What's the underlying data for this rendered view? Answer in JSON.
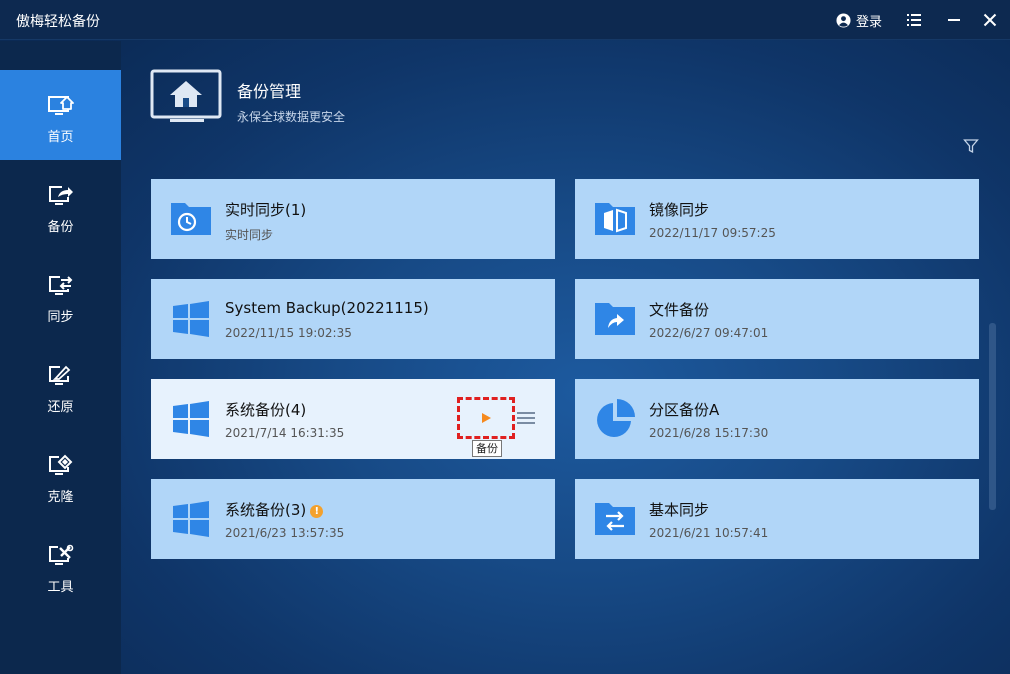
{
  "app": {
    "title": "傲梅轻松备份",
    "login_label": "登录"
  },
  "sidebar": {
    "items": [
      {
        "label": "首页",
        "icon": "home-monitor-icon",
        "active": true
      },
      {
        "label": "备份",
        "icon": "backup-icon",
        "active": false
      },
      {
        "label": "同步",
        "icon": "sync-icon",
        "active": false
      },
      {
        "label": "还原",
        "icon": "restore-icon",
        "active": false
      },
      {
        "label": "克隆",
        "icon": "clone-icon",
        "active": false
      },
      {
        "label": "工具",
        "icon": "tools-icon",
        "active": false
      }
    ]
  },
  "header": {
    "title": "备份管理",
    "subtitle": "永保全球数据更安全"
  },
  "tasks": [
    {
      "title": "实时同步(1)",
      "subtitle": "实时同步",
      "icon": "clock-folder-icon"
    },
    {
      "title": "镜像同步",
      "subtitle": "2022/11/17 09:57:25",
      "icon": "mirror-sync-icon"
    },
    {
      "title": "System Backup(20221115)",
      "subtitle": "2022/11/15 19:02:35",
      "icon": "windows-icon"
    },
    {
      "title": "文件备份",
      "subtitle": "2022/6/27 09:47:01",
      "icon": "file-backup-folder-icon"
    },
    {
      "title": "系统备份(4)",
      "subtitle": "2021/7/14 16:31:35",
      "icon": "windows-icon"
    },
    {
      "title": "分区备份A",
      "subtitle": "2021/6/28 15:17:30",
      "icon": "partition-pie-icon"
    },
    {
      "title": "系统备份(3)",
      "subtitle": "2021/6/23 13:57:35",
      "icon": "windows-icon",
      "warning": "!"
    },
    {
      "title": "基本同步",
      "subtitle": "2021/6/21 10:57:41",
      "icon": "basic-sync-folder-icon"
    }
  ],
  "tooltip": "备份",
  "colors": {
    "accent": "#2b82e0",
    "card_bg": "#b1d6f8",
    "card_hover_bg": "#e7f2fd",
    "icon_blue": "#2f86e6",
    "play_orange": "#f58a1f",
    "highlight_red": "#e02020"
  }
}
